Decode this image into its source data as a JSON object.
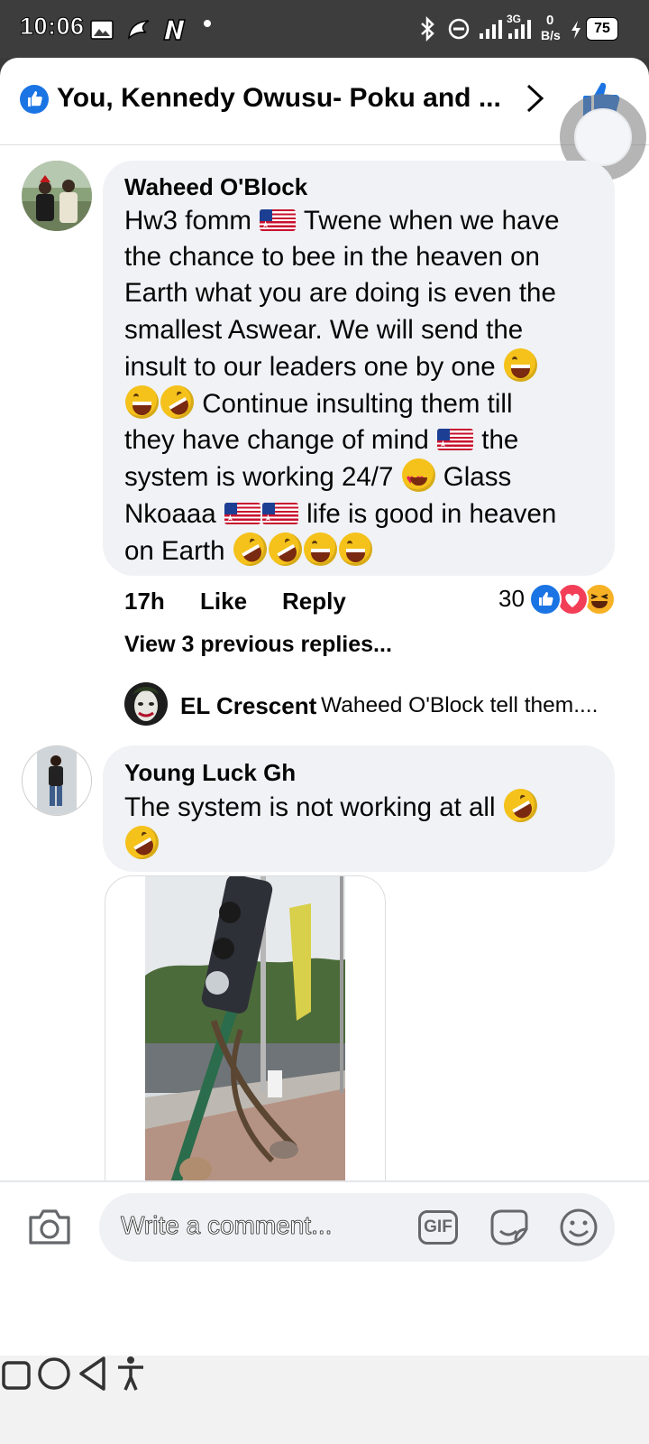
{
  "status_bar": {
    "time": "10:06",
    "network_speed_value": "0",
    "network_speed_unit": "B/s",
    "signal_label": "3G",
    "battery": "75"
  },
  "header": {
    "title": "You, Kennedy Owusu- Poku and ..."
  },
  "comments": [
    {
      "author": "Waheed O'Block",
      "lines": [
        [
          "Hw3 fomm ",
          "FLAG",
          " Twene when we have"
        ],
        [
          "the chance to bee in the heaven on"
        ],
        [
          "Earth what you are doing is even the"
        ],
        [
          "smallest Aswear. We will send the"
        ],
        [
          "insult to our leaders one by one ",
          "LAUGH"
        ],
        [
          "LAUGH",
          "ROFL",
          " Continue insulting them till"
        ],
        [
          "they have change of mind ",
          "FLAG",
          " the"
        ],
        [
          "system is working 24/7 ",
          "HEART",
          " Glass"
        ],
        [
          "Nkoaaa ",
          "FLAG",
          "FLAG",
          " life is good in heaven"
        ],
        [
          "on Earth ",
          "ROFL",
          "ROFL",
          "LAUGH",
          "LAUGH"
        ]
      ],
      "time": "17h",
      "like_label": "Like",
      "reply_label": "Reply",
      "reaction_count": "30",
      "view_previous": "View 3 previous replies...",
      "latest_reply": {
        "author": "EL Crescent",
        "text": "Waheed O'Block tell them...."
      }
    },
    {
      "author": "Young Luck Gh",
      "lines": [
        [
          "The system is not working at all ",
          "ROFL"
        ],
        [
          "ROFL"
        ]
      ]
    }
  ],
  "composer": {
    "placeholder": "Write a comment...",
    "gif_label": "GIF"
  },
  "colors": {
    "facebook_blue": "#1b74e4",
    "bubble_bg": "#f0f2f5",
    "love_red": "#f33e58",
    "haha_yellow": "#f7b125"
  },
  "icons": [
    "like-icon",
    "chevron-right-icon",
    "camera-icon",
    "gif-icon",
    "sticker-icon",
    "emoji-icon",
    "square-icon",
    "circle-icon",
    "back-triangle-icon",
    "accessibility-icon"
  ]
}
